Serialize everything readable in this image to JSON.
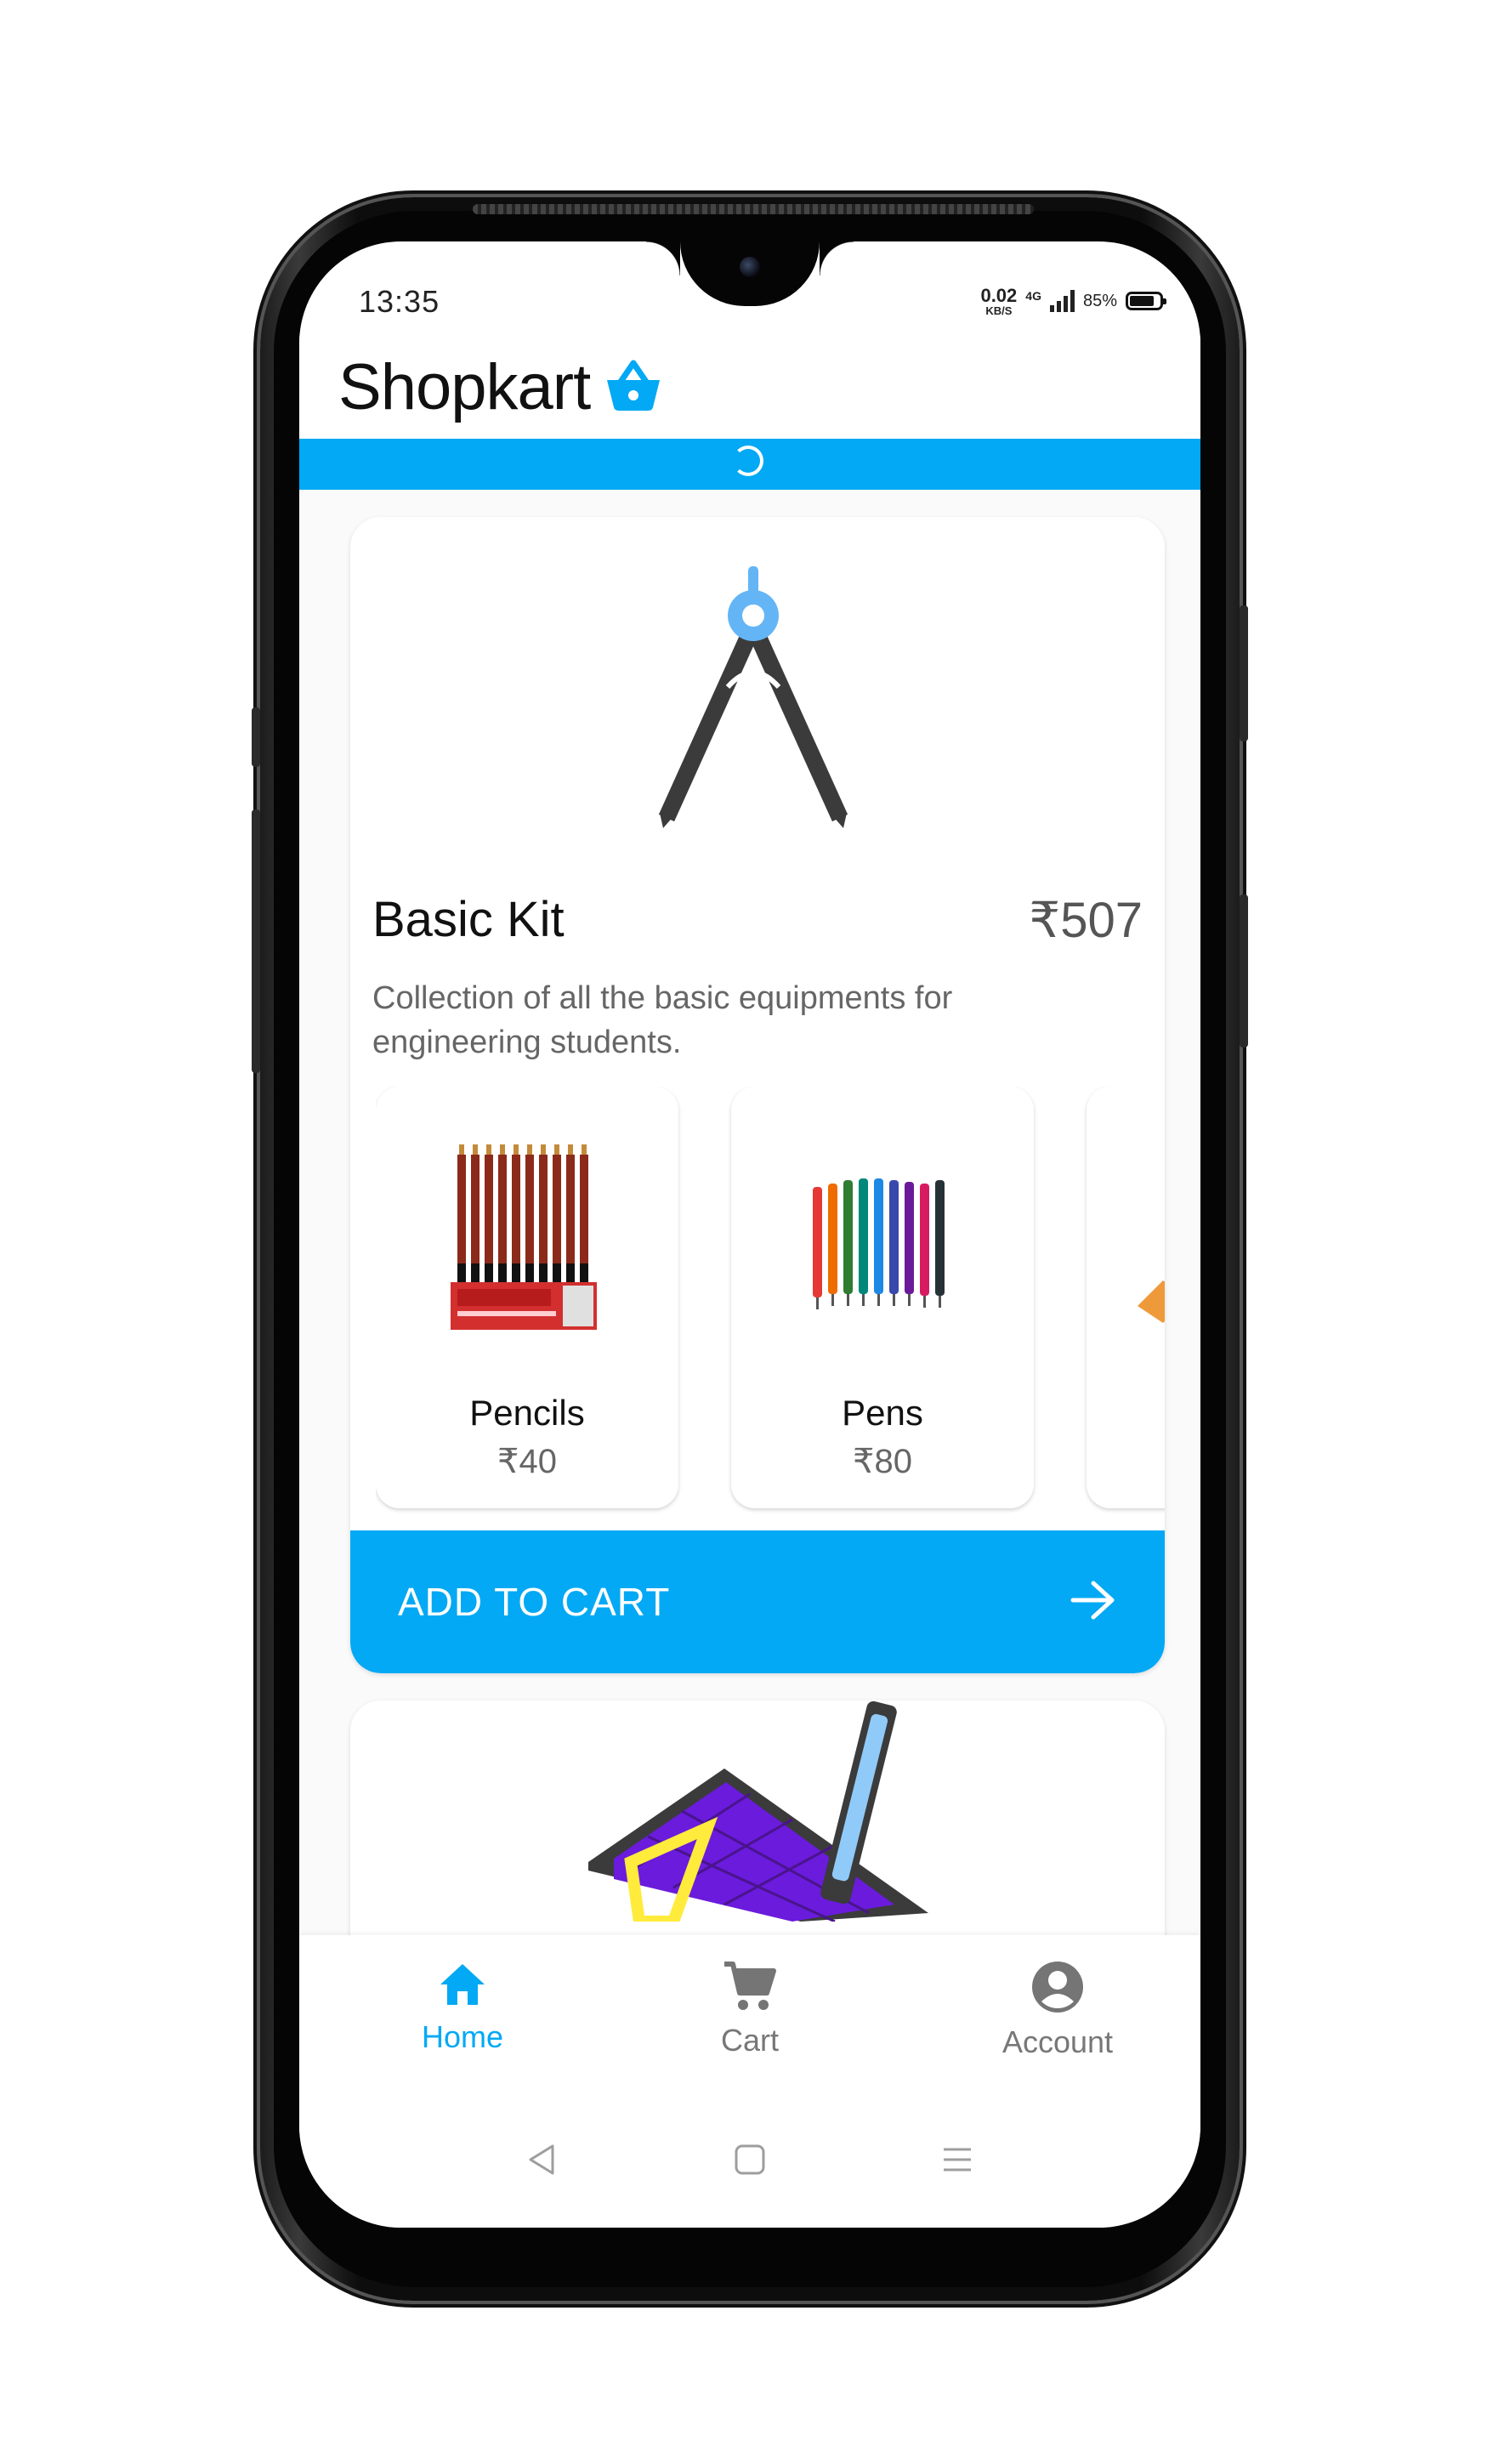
{
  "status_bar": {
    "time": "13:35",
    "net_speed_value": "0.02",
    "net_speed_unit": "KB/S",
    "network_type": "4G",
    "battery_percent": "85%"
  },
  "app": {
    "title": "Shopkart",
    "logo_icon": "shopping-basket-icon",
    "accent_color": "#03a9f4"
  },
  "loading": {
    "spinner_icon": "loading-spinner-icon"
  },
  "kits": [
    {
      "title": "Basic Kit",
      "price": "₹507",
      "description": "Collection of all the basic equipments for engineering students.",
      "image_icon": "compass-icon",
      "items": [
        {
          "name": "Pencils",
          "price": "₹40",
          "image_icon": "pencils-box-icon"
        },
        {
          "name": "Pens",
          "price": "₹80",
          "image_icon": "colored-pens-icon"
        },
        {
          "name": "",
          "price": "",
          "image_icon": "eraser-icon"
        }
      ],
      "cta_label": "ADD TO CART",
      "cta_icon": "arrow-right-icon"
    },
    {
      "image_icon": "drawing-board-icon"
    }
  ],
  "bottom_nav": {
    "items": [
      {
        "label": "Home",
        "icon": "home-icon",
        "active": true
      },
      {
        "label": "Cart",
        "icon": "cart-icon",
        "active": false
      },
      {
        "label": "Account",
        "icon": "account-circle-icon",
        "active": false
      }
    ]
  },
  "system_nav": {
    "back_icon": "back-triangle-icon",
    "home_icon": "home-square-icon",
    "menu_icon": "recents-menu-icon"
  }
}
